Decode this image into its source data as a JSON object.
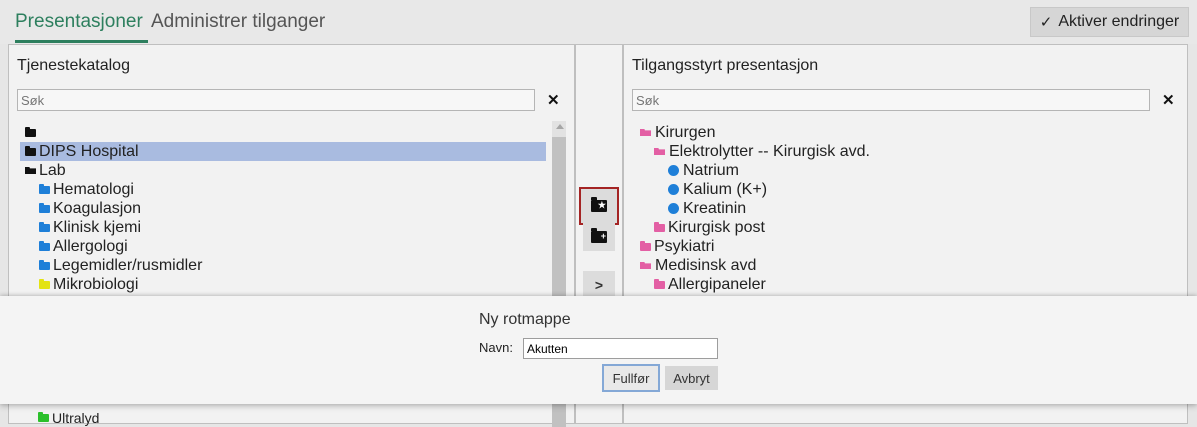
{
  "tabs": [
    {
      "label": "Presentasjoner"
    },
    {
      "label": "Administrer tilganger"
    }
  ],
  "toolbar": {
    "activate_label": "Aktiver endringer",
    "activate_icon": "check-icon"
  },
  "left_panel": {
    "title": "Tjenestekatalog",
    "search_placeholder": "Søk",
    "items": [
      {
        "label": "",
        "icon": "folder-black"
      },
      {
        "label": "DIPS Hospital",
        "icon": "folder-black",
        "selected": true
      },
      {
        "label": "Lab",
        "icon": "folder-open-black"
      },
      {
        "label": "Hematologi",
        "icon": "folder-blue"
      },
      {
        "label": "Koagulasjon",
        "icon": "folder-blue"
      },
      {
        "label": "Klinisk kjemi",
        "icon": "folder-blue"
      },
      {
        "label": "Allergologi",
        "icon": "folder-blue"
      },
      {
        "label": "Legemidler/rusmidler",
        "icon": "folder-blue"
      },
      {
        "label": "Mikrobiologi",
        "icon": "folder-yellow"
      },
      {
        "label": "Ultralyd",
        "icon": "folder-green"
      }
    ]
  },
  "right_panel": {
    "title": "Tilgangsstyrt presentasjon",
    "search_placeholder": "Søk",
    "items": [
      {
        "label": "Kirurgen",
        "icon": "folder-open-pink"
      },
      {
        "label": "Elektrolytter -- Kirurgisk avd.",
        "icon": "folder-open-pink"
      },
      {
        "label": "Natrium",
        "icon": "dot-blue"
      },
      {
        "label": "Kalium (K+)",
        "icon": "dot-blue"
      },
      {
        "label": "Kreatinin",
        "icon": "dot-blue"
      },
      {
        "label": "Kirurgisk post",
        "icon": "folder-pink"
      },
      {
        "label": "Psykiatri",
        "icon": "folder-pink"
      },
      {
        "label": "Medisinsk avd",
        "icon": "folder-open-pink"
      },
      {
        "label": "Allergipaneler",
        "icon": "folder-pink"
      }
    ]
  },
  "middle_buttons": [
    {
      "icon": "new-root-folder-icon"
    },
    {
      "icon": "new-folder-icon"
    },
    {
      "icon": "chevron-right-icon",
      "label": ">"
    }
  ],
  "dialog": {
    "title": "Ny rotmappe",
    "name_label": "Navn:",
    "name_value": "Akutten",
    "ok_label": "Fullfør",
    "cancel_label": "Avbryt"
  },
  "colors": {
    "accent": "#2d7f5e",
    "selection": "#a9bbe0",
    "folder_blue": "#1e7fd8",
    "folder_pink": "#e35fa4"
  }
}
